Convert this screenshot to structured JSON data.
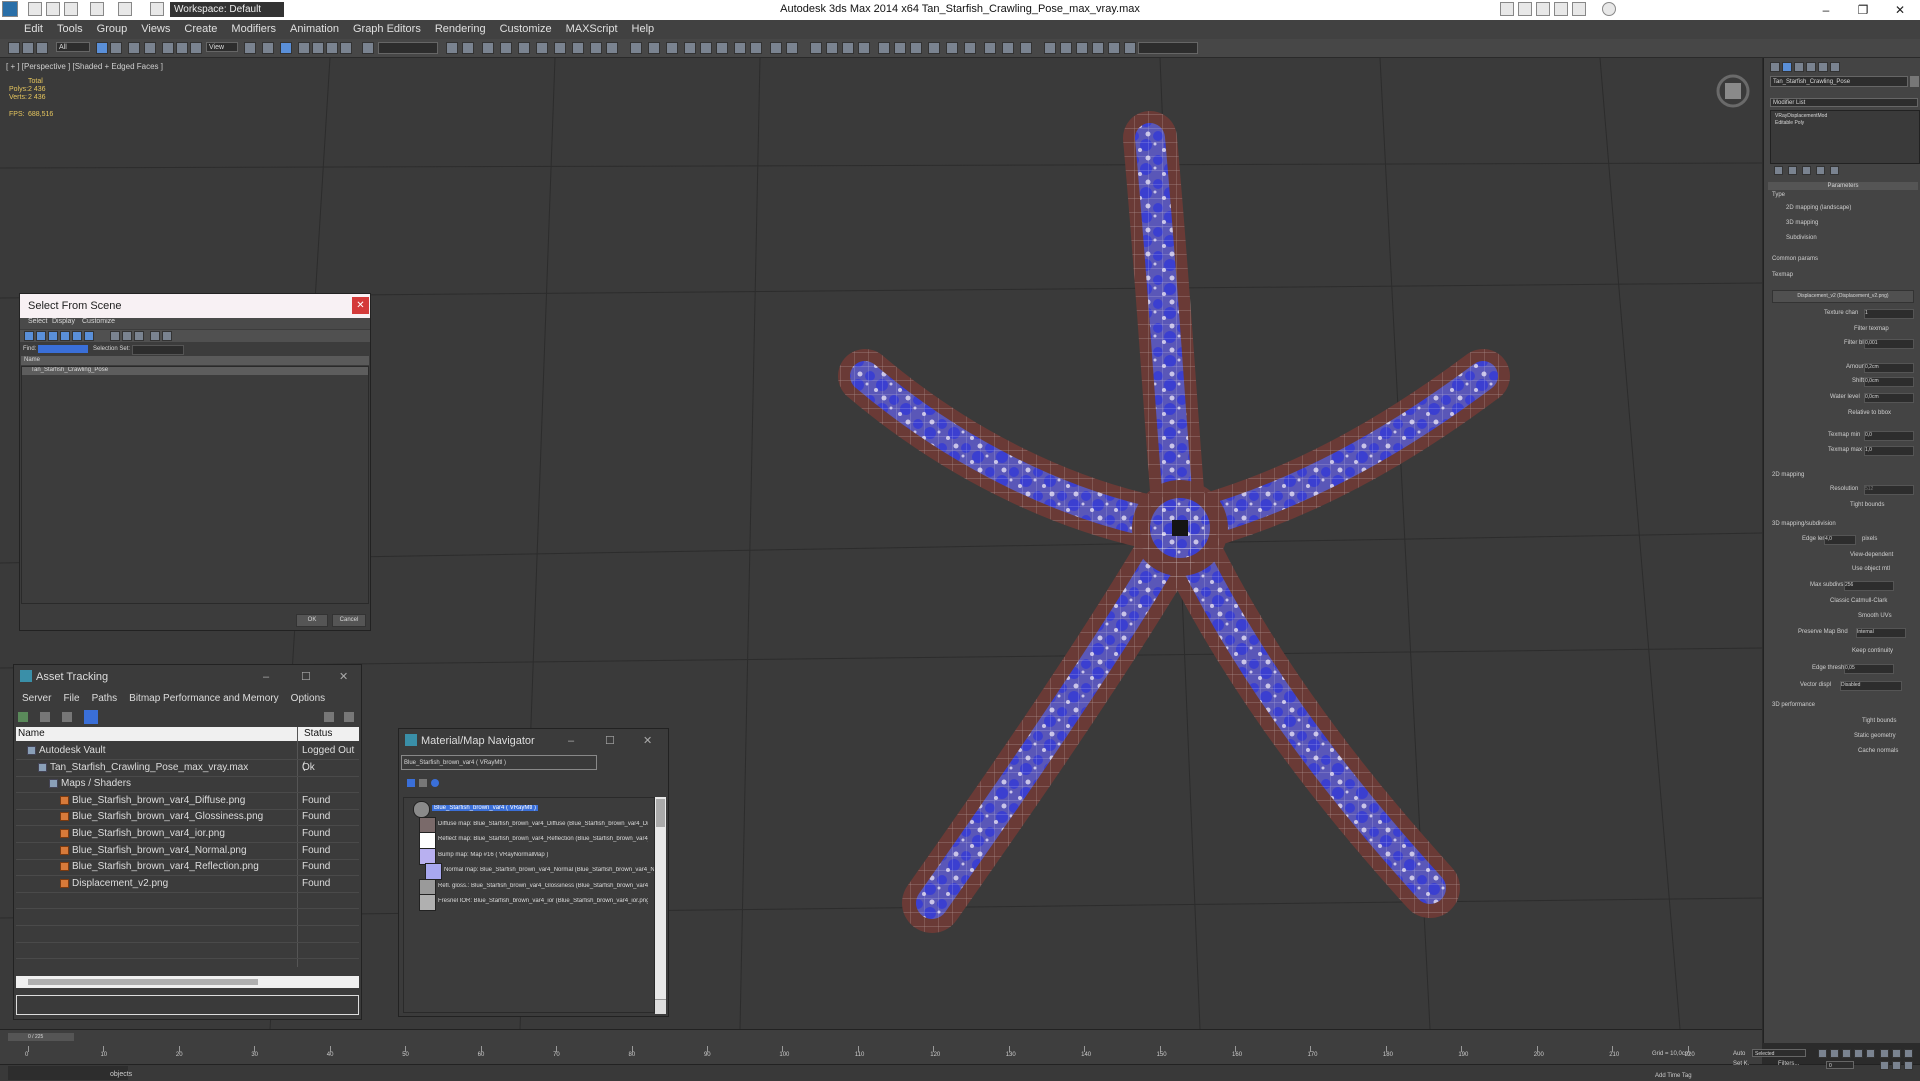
{
  "titlebar": {
    "title": "Autodesk 3ds Max  2014 x64    Tan_Starfish_Crawling_Pose_max_vray.max",
    "workspace": "Workspace: Default",
    "minimize": "–",
    "maximize": "❐",
    "close": "✕"
  },
  "menu": [
    "Edit",
    "Tools",
    "Group",
    "Views",
    "Create",
    "Modifiers",
    "Animation",
    "Graph Editors",
    "Rendering",
    "Customize",
    "MAXScript",
    "Help"
  ],
  "toolbar": {
    "selection_filter": "All",
    "view": "View"
  },
  "viewport": {
    "label": "[ + ] [Perspective ] [Shaded + Edged Faces ]",
    "stats": {
      "total": "Total",
      "polys_label": "Polys:",
      "polys": "2 436",
      "verts_label": "Verts:",
      "verts": "2 436",
      "fps_label": "FPS:",
      "fps": "688,516"
    }
  },
  "select_from_scene": {
    "title": "Select From Scene",
    "menu": [
      "Select",
      "Display",
      "Customize"
    ],
    "find_label": "Find:",
    "selection_set_label": "Selection Set:",
    "column_name": "Name",
    "items": [
      "Tan_Starfish_Crawling_Pose"
    ],
    "ok": "OK",
    "cancel": "Cancel"
  },
  "asset_tracking": {
    "title": "Asset Tracking",
    "menu": [
      "Server",
      "File",
      "Paths",
      "Bitmap Performance and Memory",
      "Options"
    ],
    "col_name": "Name",
    "col_status": "Status",
    "rows": [
      {
        "name": "Autodesk Vault",
        "status": "Logged Out (",
        "indent": 1
      },
      {
        "name": "Tan_Starfish_Crawling_Pose_max_vray.max",
        "status": "Ok",
        "indent": 2
      },
      {
        "name": "Maps / Shaders",
        "status": "",
        "indent": 3
      },
      {
        "name": "Blue_Starfish_brown_var4_Diffuse.png",
        "status": "Found",
        "indent": 4
      },
      {
        "name": "Blue_Starfish_brown_var4_Glossiness.png",
        "status": "Found",
        "indent": 4
      },
      {
        "name": "Blue_Starfish_brown_var4_ior.png",
        "status": "Found",
        "indent": 4
      },
      {
        "name": "Blue_Starfish_brown_var4_Normal.png",
        "status": "Found",
        "indent": 4
      },
      {
        "name": "Blue_Starfish_brown_var4_Reflection.png",
        "status": "Found",
        "indent": 4
      },
      {
        "name": "Displacement_v2.png",
        "status": "Found",
        "indent": 4
      }
    ]
  },
  "material_navigator": {
    "title": "Material/Map Navigator",
    "current": "Blue_Starfish_brown_var4  ( VRayMtl )",
    "items": [
      "Blue_Starfish_brown_var4  ( VRayMtl )",
      "Diffuse map: Blue_Starfish_brown_var4_Diffuse (Blue_Starfish_brown_var4_Diffuse.png)",
      "Reflect map: Blue_Starfish_brown_var4_Reflection (Blue_Starfish_brown_var4_Reflection.png)",
      "Bump map: Map #16  ( VRayNormalMap )",
      "Normal map: Blue_Starfish_brown_var4_Normal (Blue_Starfish_brown_var4_Normal.png)",
      "Refl. gloss.: Blue_Starfish_brown_var4_Glossiness (Blue_Starfish_brown_var4_Glossiness.png)",
      "Fresnel IOR: Blue_Starfish_brown_var4_ior (Blue_Starfish_brown_var4_ior.png)"
    ]
  },
  "command_panel": {
    "object_name": "Tan_Starfish_Crawling_Pose",
    "modifier_list": "Modifier List",
    "stack": [
      "VRayDisplacementMod",
      "Editable Poly"
    ],
    "rollout_title": "Parameters",
    "type_label": "Type",
    "types": [
      "2D mapping (landscape)",
      "3D mapping",
      "Subdivision"
    ],
    "common_params": "Common params",
    "texmap_label": "Texmap",
    "texmap_button": "Displacement_v2 (Displacement_v2.png)",
    "texture_chan": "Texture chan",
    "texture_chan_val": "1",
    "filter_texmap": "Filter texmap",
    "filter_blur": "Filter blur",
    "filter_blur_val": "0,001",
    "amount": "Amount",
    "amount_val": "0,2cm",
    "shift": "Shift",
    "shift_val": "0,0cm",
    "water_level": "Water level",
    "water_level_val": "0,0cm",
    "relative_to_bbox": "Relative to bbox",
    "texmap_min": "Texmap min",
    "texmap_min_val": "0,0",
    "texmap_max": "Texmap max",
    "texmap_max_val": "1,0",
    "mapping_2d": "2D mapping",
    "resolution": "Resolution",
    "resolution_val": "512",
    "tight_bounds": "Tight bounds",
    "mapping_3d": "3D mapping/subdivision",
    "edge_length": "Edge length",
    "edge_length_val": "4,0",
    "pixels": "pixels",
    "view_dependent": "View-dependent",
    "use_object_mtl": "Use object mtl",
    "max_subdivs": "Max subdivs",
    "max_subdivs_val": "256",
    "classic_catmull": "Classic Catmull-Clark",
    "smooth_uvs": "Smooth UVs",
    "preserve_map_bnd": "Preserve Map Bnd",
    "preserve_map_bnd_val": "Internal",
    "keep_continuity": "Keep continuity",
    "edge_thresh": "Edge thresh",
    "edge_thresh_val": "0,05",
    "vector_displ": "Vector displ",
    "vector_displ_val": "Disabled",
    "perf_3d": "3D performance",
    "tight_bounds2": "Tight bounds",
    "static_geometry": "Static geometry",
    "cache_normals": "Cache normals"
  },
  "timeline": {
    "frame": "0 / 225",
    "ticks": [
      "0",
      "10",
      "20",
      "30",
      "40",
      "50",
      "60",
      "70",
      "80",
      "90",
      "100",
      "110",
      "120",
      "130",
      "140",
      "150",
      "160",
      "170",
      "180",
      "190",
      "200",
      "210",
      "220"
    ]
  },
  "status": {
    "objects": "objects",
    "grid": "Grid = 10,0cm",
    "auto": "Auto",
    "selected": "Selected",
    "set_key": "Set K.",
    "filters": "Filters...",
    "add_time_tag": "Add Time Tag",
    "frame_val": "0"
  },
  "colors": {
    "starfish_body": "#6a3a36",
    "starfish_spots": "#3d48c8",
    "viewport_bg": "#3a3a3a",
    "select_highlight": "#3a6fd8"
  }
}
